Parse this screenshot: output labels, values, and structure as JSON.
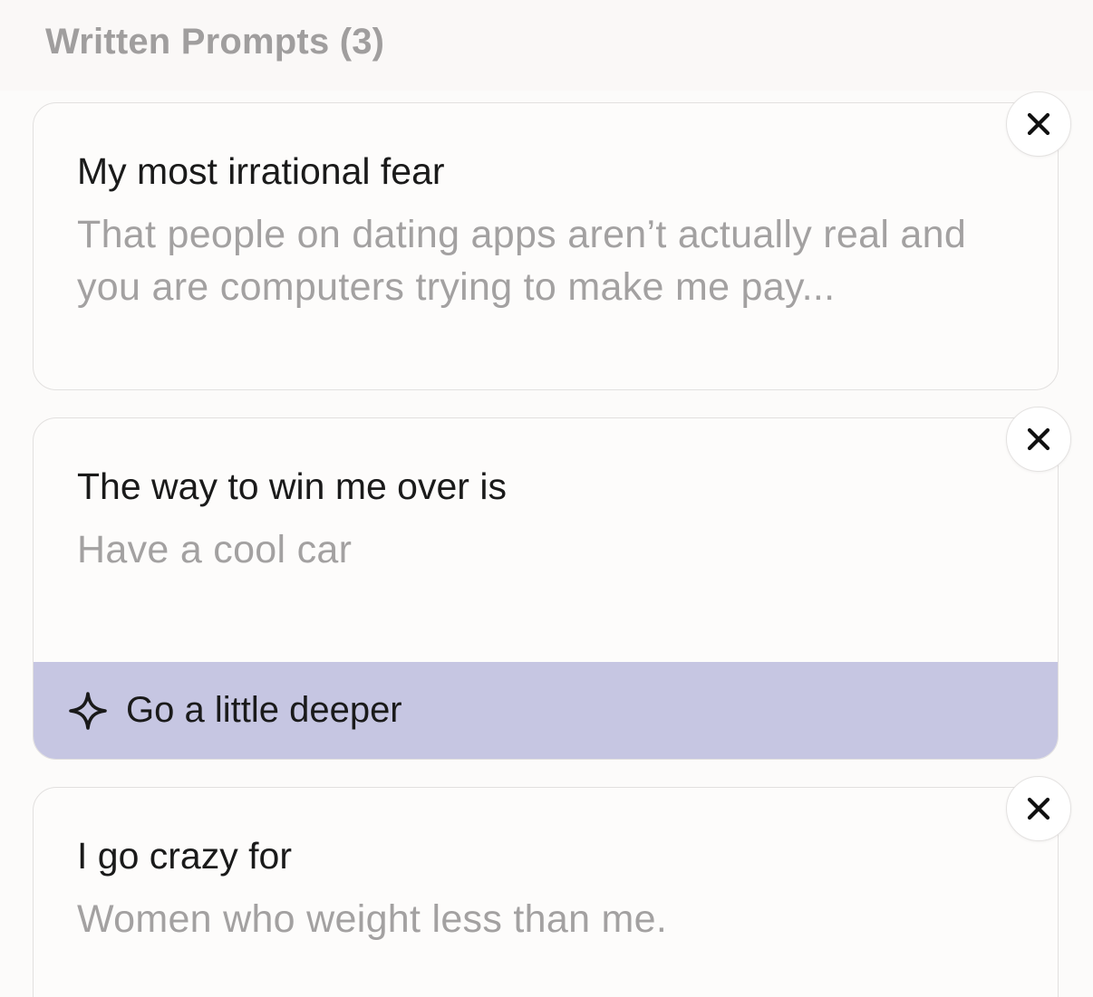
{
  "section": {
    "title": "Written Prompts (3)"
  },
  "prompts": [
    {
      "question": "My most irrational fear",
      "answer": "That people on dating apps aren’t actually real and you are computers trying to make me pay..."
    },
    {
      "question": "The way to win me over is",
      "answer": "Have a cool car",
      "action_label": "Go a little deeper",
      "action_icon": "sparkle-icon"
    },
    {
      "question": "I go crazy for",
      "answer": "Women who weight less than me."
    }
  ],
  "icons": {
    "remove": "close-icon"
  },
  "colors": {
    "accent_bar": "#c6c6e2",
    "question_text": "#1a1a1a",
    "answer_text": "#a3a1a1",
    "header_text": "#a09e9e"
  }
}
